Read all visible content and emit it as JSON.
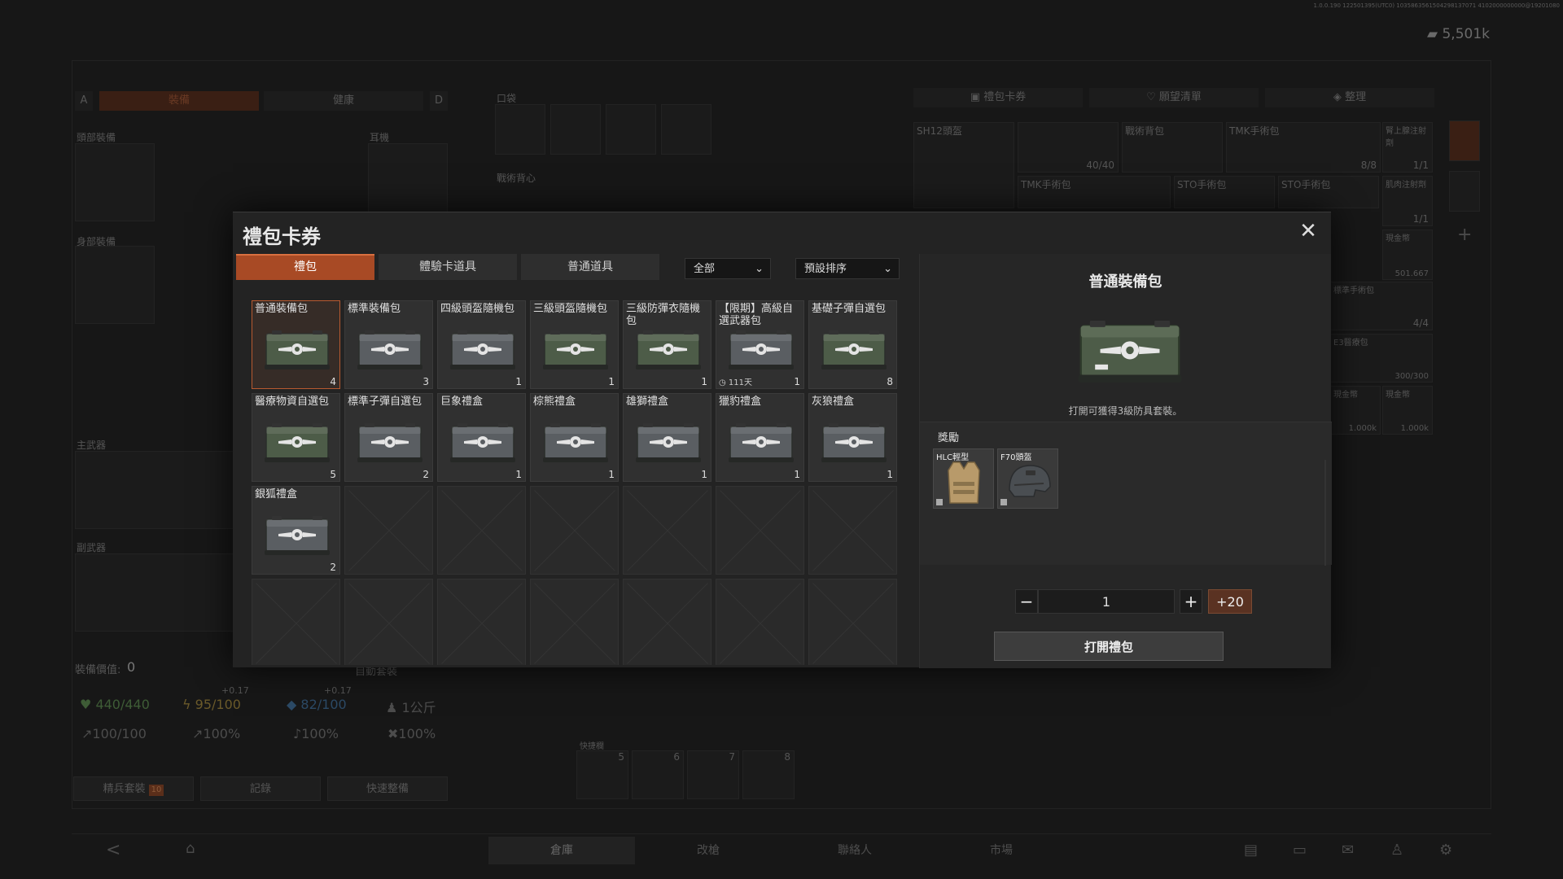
{
  "background": {
    "currency": "5,501k",
    "debug": "1.0.0.190 122501395(UTC0) 1035863561504298137071 4102000000000@19201080",
    "left_tabs": [
      "A",
      "裝備",
      "健康",
      "D"
    ],
    "slot_labels": [
      "頭部裝備",
      "耳機",
      "身部裝備",
      "口袋",
      "戰術背心",
      "主武器",
      "副武器"
    ],
    "equip_value_label": "裝備價值:",
    "equip_value": "0",
    "auto_equip": "自動套裝",
    "stats": {
      "hp": "440/440",
      "energy": "95/100",
      "energy_delta": "+0.17",
      "water": "82/100",
      "water_delta": "+0.17",
      "weight": "1公斤",
      "s1": "100/100",
      "s2": "100%",
      "s3": "100%",
      "s4": "100%"
    },
    "bottom_buttons": [
      "精兵套裝",
      "記錄",
      "快速整備"
    ],
    "elite_badge": "10",
    "quick_bar_label": "快捷欄",
    "quick_slots": [
      "5",
      "6",
      "7",
      "8"
    ],
    "right_tabs": [
      "禮包卡券",
      "願望清單",
      "整理"
    ],
    "stash_items": [
      {
        "name": "SH12頭盔",
        "count": ""
      },
      {
        "name": "",
        "count": "40/40"
      },
      {
        "name": "戰術背包",
        "count": ""
      },
      {
        "name": "TMK手術包",
        "count": "8/8"
      },
      {
        "name": "腎上腺注射劑",
        "count": "1/1"
      },
      {
        "name": "TMK手術包",
        "count": ""
      },
      {
        "name": "STO手術包",
        "count": ""
      },
      {
        "name": "STO手術包",
        "count": "12/12"
      },
      {
        "name": "肌肉注射劑",
        "count": "1/1"
      },
      {
        "name": "現金幣",
        "count": "501.667"
      },
      {
        "name": "標準手術包",
        "count": "4/4"
      },
      {
        "name": "E3醫療包",
        "count": "300/300"
      },
      {
        "name": "現金幣",
        "count": "1.000k"
      },
      {
        "name": "現金幣",
        "count": "1.000k"
      }
    ],
    "nav_tabs": [
      "倉庫",
      "改槍",
      "聯絡人",
      "市場"
    ]
  },
  "modal": {
    "title": "禮包卡券",
    "tabs": [
      {
        "label": "禮包",
        "active": true
      },
      {
        "label": "體驗卡道具",
        "active": false
      },
      {
        "label": "普通道具",
        "active": false
      }
    ],
    "filter": "全部",
    "sort": "預設排序",
    "items": [
      {
        "name": "普通裝備包",
        "count": "4",
        "color": "#4d5c48",
        "selected": true
      },
      {
        "name": "標準裝備包",
        "count": "3",
        "color": "#5a5e62"
      },
      {
        "name": "四級頭盔隨機包",
        "count": "1",
        "color": "#5a5e62"
      },
      {
        "name": "三級頭盔隨機包",
        "count": "1",
        "color": "#4d5c48"
      },
      {
        "name": "三級防彈衣隨機包",
        "count": "1",
        "color": "#4d5c48"
      },
      {
        "name": "【限期】高級自選武器包",
        "count": "1",
        "color": "#5a5e62",
        "extra": "111天"
      },
      {
        "name": "基礎子彈自選包",
        "count": "8",
        "color": "#4d5c48"
      },
      {
        "name": "醫療物資自選包",
        "count": "5",
        "color": "#4d5c48"
      },
      {
        "name": "標準子彈自選包",
        "count": "2",
        "color": "#5a5e62"
      },
      {
        "name": "巨象禮盒",
        "count": "1",
        "color": "#5a5e62"
      },
      {
        "name": "棕熊禮盒",
        "count": "1",
        "color": "#5a5e62"
      },
      {
        "name": "雄獅禮盒",
        "count": "1",
        "color": "#5a5e62"
      },
      {
        "name": "獵豹禮盒",
        "count": "1",
        "color": "#5a5e62"
      },
      {
        "name": "灰狼禮盒",
        "count": "1",
        "color": "#5a5e62"
      },
      {
        "name": "銀狐禮盒",
        "count": "2",
        "color": "#5a5e62"
      }
    ],
    "detail": {
      "title": "普通裝備包",
      "description": "打開可獲得3級防具套裝。",
      "rewards_label": "獎勵",
      "rewards": [
        {
          "name": "HLC輕型"
        },
        {
          "name": "F70頭盔"
        }
      ],
      "quantity": "1",
      "minus": "−",
      "plus": "+",
      "plus20": "+20",
      "open_label": "打開禮包"
    },
    "close": "✕"
  },
  "colors": {
    "accent": "#a84a25",
    "selected_border": "#b85a30"
  }
}
